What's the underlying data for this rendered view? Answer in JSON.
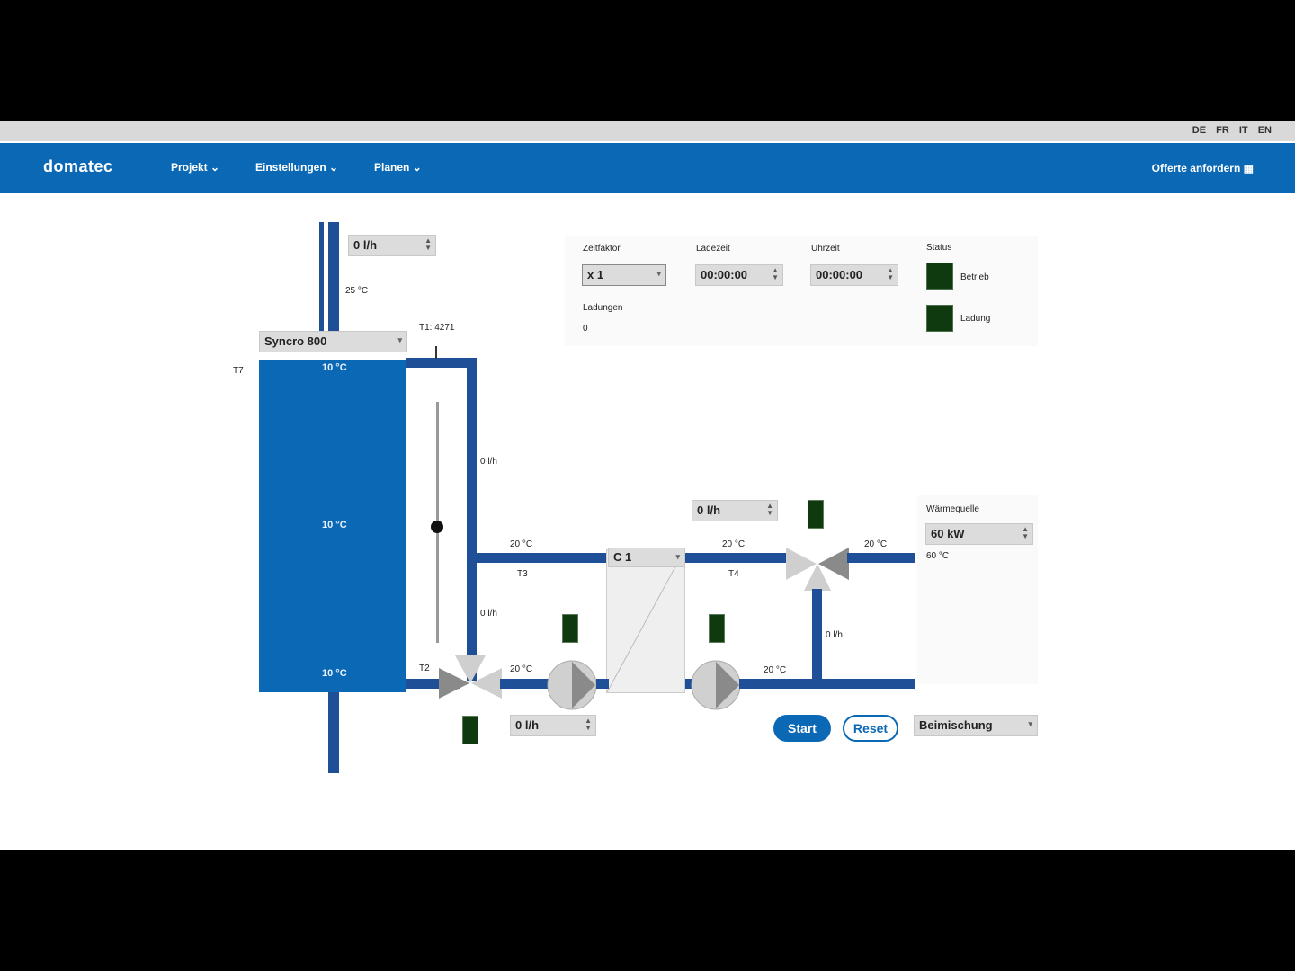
{
  "app": {
    "logo": "domatec",
    "languages": [
      "DE",
      "FR",
      "IT",
      "EN"
    ],
    "nav": [
      "Projekt",
      "Einstellungen",
      "Planen"
    ],
    "nav_right": "Offerte anfordern",
    "accent": "#0b68b4",
    "pipe_color": "#1f4f96",
    "indicator_color": "#0f3a10"
  },
  "controls": {
    "zeitfaktor_label": "Zeitfaktor",
    "zeitfaktor_value": "x 1",
    "ladezeit_label": "Ladezeit",
    "ladezeit_value": "00:00:00",
    "uhrzeit_label": "Uhrzeit",
    "uhrzeit_value": "00:00:00",
    "status_label": "Status",
    "status_betrieb": "Betrieb",
    "status_ladung": "Ladung",
    "ladungen_label": "Ladungen",
    "ladungen_value": "0"
  },
  "diagram": {
    "top_flow": "0 l/h",
    "top_temp": "25 °C",
    "tank_model": "Syncro 800",
    "t1_label": "T1: 4271",
    "t7_label": "T7",
    "tank_top_temp": "10 °C",
    "tank_mid_temp": "10 °C",
    "tank_bottom_temp": "10 °C",
    "t2_label": "T2",
    "right_pipe_flow_upper": "0 l/h",
    "right_pipe_flow_lower": "0 l/h",
    "t3_temp": "20 °C",
    "t3_label": "T3",
    "hx_model": "C 1",
    "t4_temp": "20 °C",
    "t4_label": "T4",
    "mid_flow": "0 l/h",
    "right_temp": "20 °C",
    "waermequelle_label": "Wärmequelle",
    "waermequelle_value": "60 kW",
    "waermequelle_temp": "60 °C",
    "vertical_right_flow": "0 l/h",
    "bottom_temp_left": "20 °C",
    "bottom_temp_right": "20 °C",
    "bottom_flow": "0 l/h",
    "mode_value": "Beimischung",
    "start_label": "Start",
    "reset_label": "Reset"
  }
}
